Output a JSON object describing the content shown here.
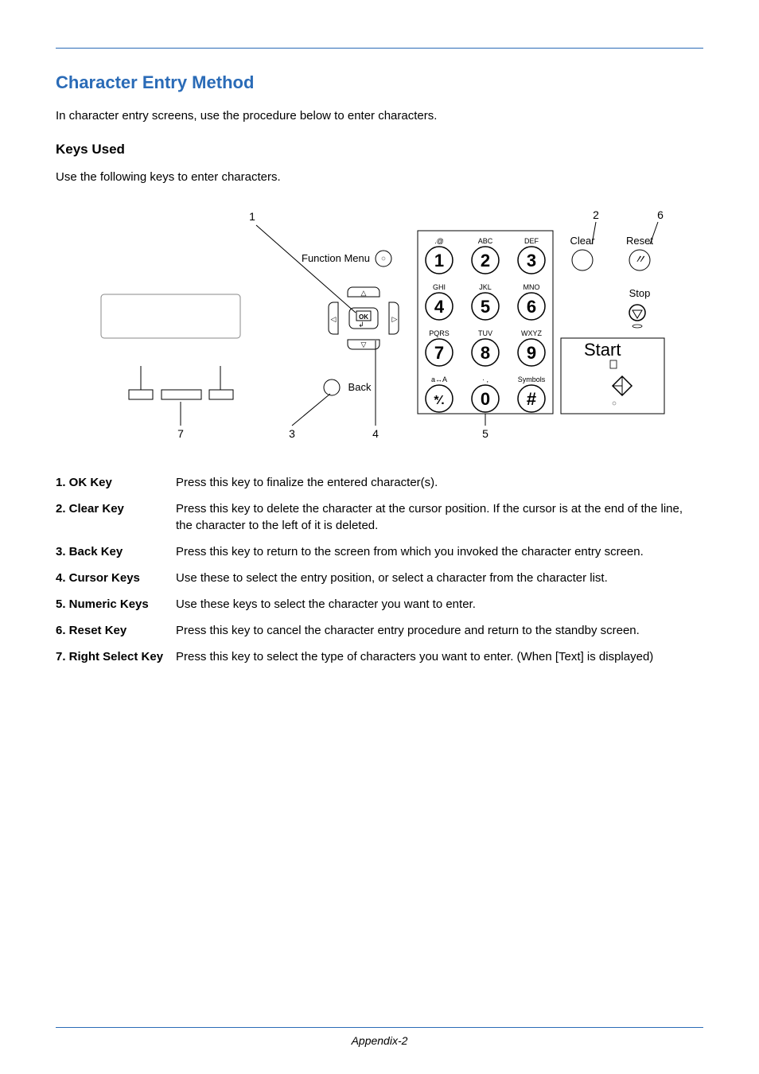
{
  "title": "Character Entry Method",
  "intro": "In character entry screens, use the procedure below to enter characters.",
  "subhead": "Keys Used",
  "subtext": "Use the following keys to enter characters.",
  "diagram": {
    "callouts": {
      "n1": "1",
      "n2": "2",
      "n3": "3",
      "n4": "4",
      "n5": "5",
      "n6": "6",
      "n7": "7"
    },
    "labels": {
      "function_menu": "Function Menu",
      "back": "Back",
      "ok": "OK",
      "clear": "Clear",
      "reset": "Reset",
      "stop": "Stop",
      "start": "Start"
    },
    "keypad": {
      "r1": {
        "a": {
          "n": "1",
          "t": ".@"
        },
        "b": {
          "n": "2",
          "t": "ABC"
        },
        "c": {
          "n": "3",
          "t": "DEF"
        }
      },
      "r2": {
        "a": {
          "n": "4",
          "t": "GHI"
        },
        "b": {
          "n": "5",
          "t": "JKL"
        },
        "c": {
          "n": "6",
          "t": "MNO"
        }
      },
      "r3": {
        "a": {
          "n": "7",
          "t": "PQRS"
        },
        "b": {
          "n": "8",
          "t": "TUV"
        },
        "c": {
          "n": "9",
          "t": "WXYZ"
        }
      },
      "r4": {
        "a": {
          "n": "*⁄.",
          "t": "a↔A"
        },
        "b": {
          "n": "0",
          "t": "· ,"
        },
        "c": {
          "n": "#",
          "t": "Symbols"
        }
      }
    }
  },
  "defs": [
    {
      "term": "1. OK Key",
      "desc": "Press this key to finalize the entered character(s)."
    },
    {
      "term": "2. Clear Key",
      "desc": "Press this key to delete the character at the cursor position. If the cursor is at the end of the line, the character to the left of it is deleted."
    },
    {
      "term": "3. Back Key",
      "desc": "Press this key to return to the screen from which you invoked the character entry screen."
    },
    {
      "term": "4. Cursor Keys",
      "desc": "Use these to select the entry position, or select a character from the character list."
    },
    {
      "term": "5. Numeric Keys",
      "desc": "Use these keys to select the character you want to enter."
    },
    {
      "term": "6. Reset Key",
      "desc": "Press this key to cancel the character entry procedure and return to the standby screen."
    },
    {
      "term": "7. Right Select Key",
      "desc": "Press this key to select the type of characters you want to enter. (When [Text] is displayed)"
    }
  ],
  "footer": "Appendix-2"
}
